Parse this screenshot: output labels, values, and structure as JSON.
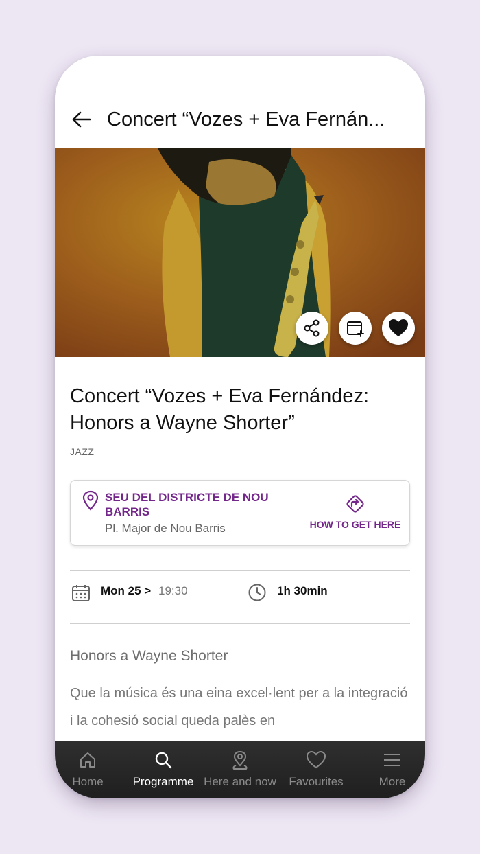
{
  "header": {
    "title": "Concert “Vozes + Eva Fernán..."
  },
  "hero": {
    "image_desc": "photo"
  },
  "event": {
    "title_line1": "Concert “Vozes + Eva Fernández:",
    "title_line2": "Honors a Wayne Shorter”",
    "category": "JAZZ"
  },
  "venue": {
    "name_line1": "SEU DEL DISTRICTE DE NOU",
    "name_line2": "BARRIS",
    "address": "Pl. Major de Nou Barris",
    "directions_label": "HOW TO GET HERE"
  },
  "schedule": {
    "date": "Mon 25 >",
    "time": "19:30",
    "duration": "1h 30min"
  },
  "description": {
    "subtitle": "Honors a Wayne Shorter",
    "text": "Que la música és una eina excel·lent per a la integració i la cohesió social queda palès en"
  },
  "nav": {
    "items": [
      {
        "label": "Home",
        "icon": "home-icon"
      },
      {
        "label": "Programme",
        "icon": "search-icon"
      },
      {
        "label": "Here and now",
        "icon": "location-icon"
      },
      {
        "label": "Favourites",
        "icon": "heart-icon"
      },
      {
        "label": "More",
        "icon": "menu-icon"
      }
    ],
    "active": "Programme"
  },
  "colors": {
    "accent": "#74278a",
    "background": "#ede6f3",
    "nav": "#252525"
  }
}
